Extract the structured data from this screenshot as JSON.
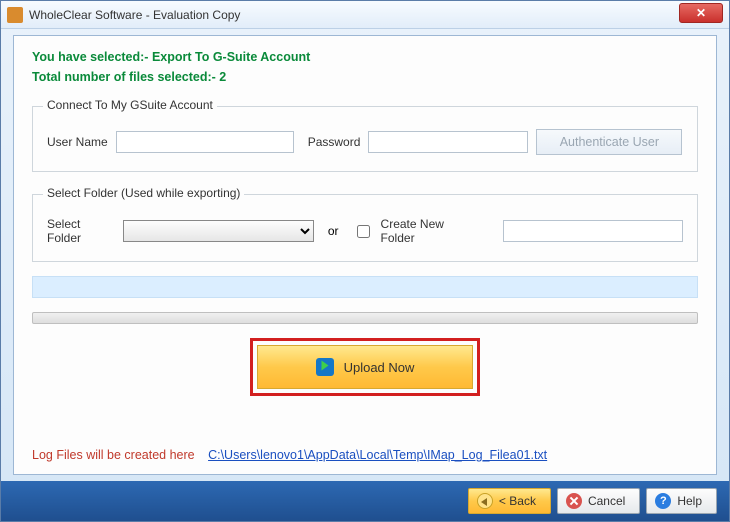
{
  "window": {
    "title": "WholeClear Software - Evaluation Copy"
  },
  "summary": {
    "selected": "You have selected:- Export To G-Suite Account",
    "filecount": "Total number of files selected:- 2"
  },
  "connect": {
    "legend": "Connect To My GSuite Account",
    "username_label": "User Name",
    "username_value": "",
    "password_label": "Password",
    "password_value": "",
    "authenticate_label": "Authenticate User"
  },
  "folder": {
    "legend": "Select Folder (Used while exporting)",
    "select_label": "Select Folder",
    "select_value": "",
    "or_label": "or",
    "create_label": "Create New Folder",
    "new_folder_value": ""
  },
  "upload": {
    "label": "Upload Now"
  },
  "log": {
    "label": "Log Files will be created here",
    "path": "C:\\Users\\lenovo1\\AppData\\Local\\Temp\\IMap_Log_Filea01.txt"
  },
  "footer": {
    "back": "< Back",
    "cancel": "Cancel",
    "help": "Help"
  }
}
